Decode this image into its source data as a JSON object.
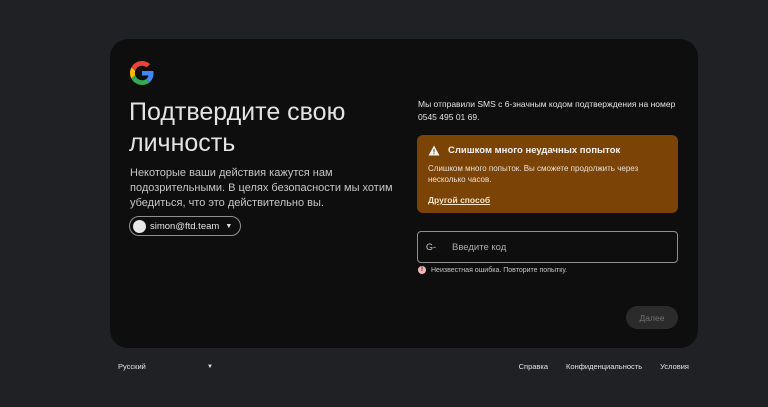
{
  "card": {
    "title": "Подтвердите свою личность",
    "description": "Некоторые ваши действия кажутся нам подозрительными. В целях безопасности мы хотим убедиться, что это действительно вы.",
    "account_email": "simon@ftd.team",
    "sms_text": "Мы отправили SMS с 6-значным кодом подтверждения на номер 0545 495 01 69.",
    "warning": {
      "title": "Слишком много неудачных попыток",
      "body": "Слишком много попыток. Вы сможете продолжить через несколько часов.",
      "link": "Другой способ"
    },
    "code_field": {
      "prefix": "G-",
      "placeholder": "Введите код",
      "value": ""
    },
    "error_text": "Неизвестная ошибка. Повторите попытку.",
    "next_button": "Далее"
  },
  "footer": {
    "language": "Русский",
    "links": [
      "Справка",
      "Конфиденциальность",
      "Условия"
    ]
  },
  "colors": {
    "page_bg": "#202124",
    "card_bg": "#0e0e0e",
    "warning_bg": "#7b4305",
    "error_icon": "#f2b8b5"
  },
  "icons": {
    "logo": "google-g-icon",
    "warning": "warning-triangle-icon",
    "error": "error-circle-icon",
    "dropdown": "caret-down-icon"
  }
}
